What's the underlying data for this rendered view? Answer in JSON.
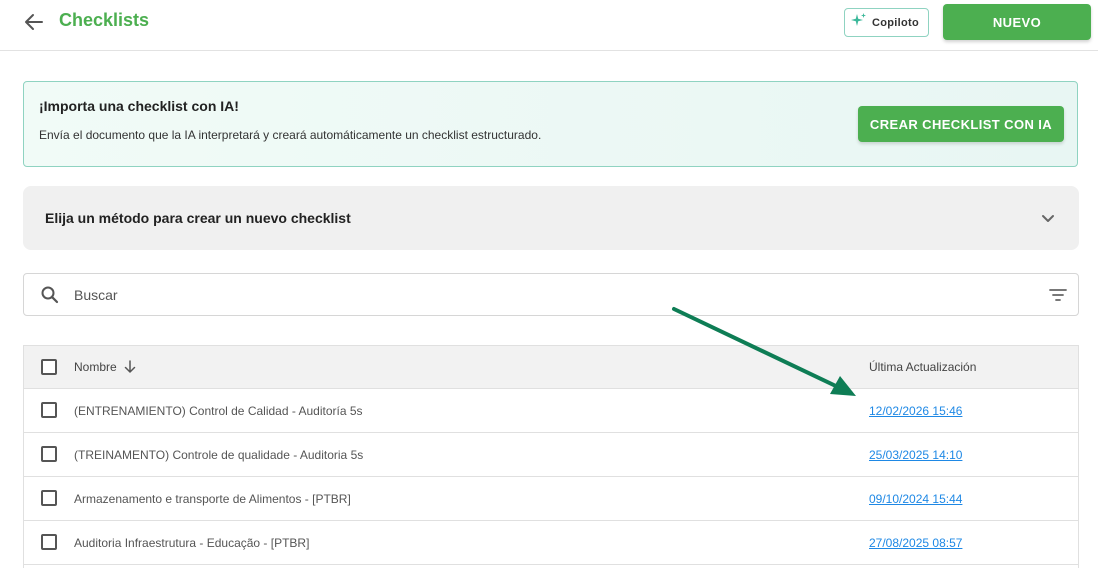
{
  "header": {
    "title": "Checklists",
    "copilot_label": "Copiloto",
    "new_label": "NUEVO"
  },
  "ai_banner": {
    "title": "¡Importa una checklist con IA!",
    "description": "Envía el documento que la IA interpretará y creará automáticamente un checklist estructurado.",
    "button_label": "CREAR CHECKLIST CON IA"
  },
  "method_panel": {
    "label": "Elija un método para crear un nuevo checklist"
  },
  "search": {
    "placeholder": "Buscar"
  },
  "table": {
    "columns": {
      "name": "Nombre",
      "updated": "Última Actualización"
    },
    "rows": [
      {
        "name": "(ENTRENAMIENTO) Control de Calidad - Auditoría 5s",
        "updated": "12/02/2026 15:46"
      },
      {
        "name": "(TREINAMENTO) Controle de qualidade -  Auditoria 5s",
        "updated": "25/03/2025 14:10"
      },
      {
        "name": "Armazenamento e transporte de Alimentos - [PTBR]",
        "updated": "09/10/2024 15:44"
      },
      {
        "name": "Auditoria Infraestrutura - Educação - [PTBR]",
        "updated": "27/08/2025 08:57"
      }
    ]
  },
  "colors": {
    "primary": "#4caf50",
    "link": "#1e88e5",
    "annotation_arrow": "#0e7d55",
    "banner_border": "#8fd3c1"
  },
  "icons": {
    "back": "arrow-left-icon",
    "copilot": "sparkle-icon",
    "chevron": "chevron-down-icon",
    "search": "search-icon",
    "filter": "filter-icon",
    "sort": "arrow-down-icon"
  }
}
